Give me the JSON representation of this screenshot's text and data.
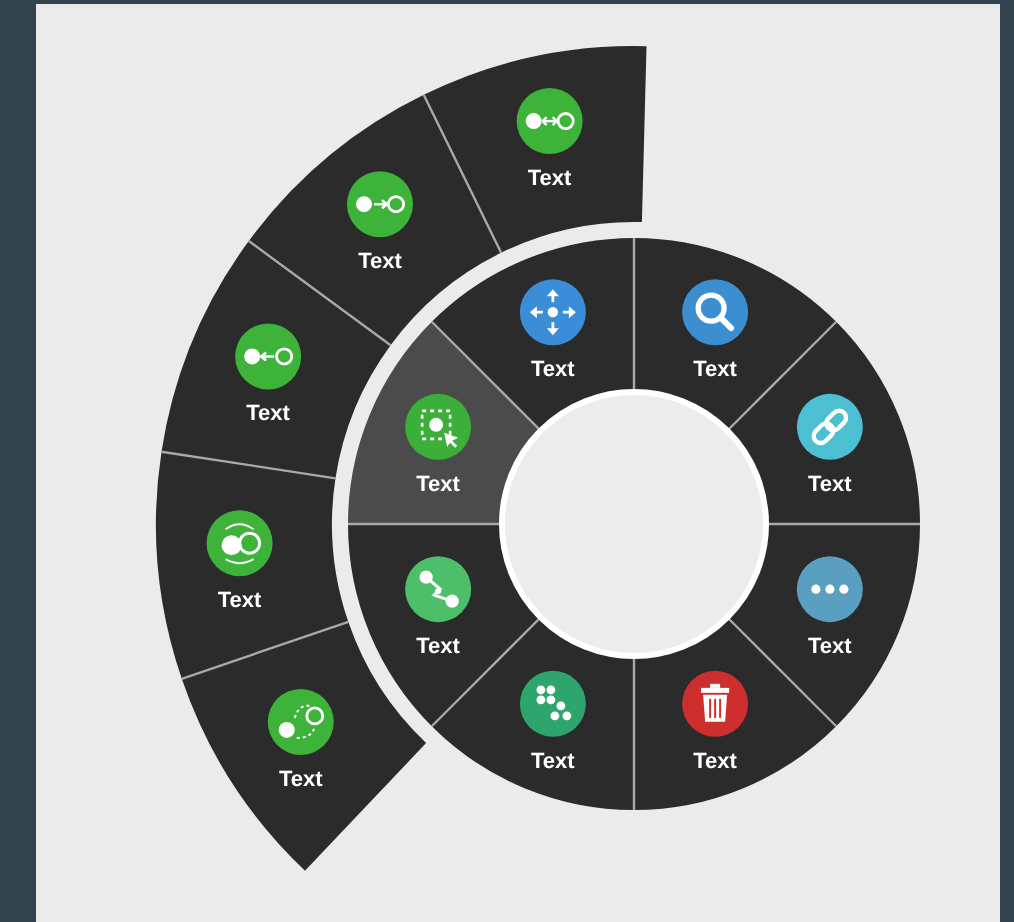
{
  "inner_ring": {
    "items": [
      {
        "kind": "search",
        "label": "Text",
        "color": "#3b8fd1",
        "selected": false
      },
      {
        "kind": "link",
        "label": "Text",
        "color": "#4cbfd3",
        "selected": false
      },
      {
        "kind": "more",
        "label": "Text",
        "color": "#5b9fc0",
        "selected": false
      },
      {
        "kind": "trash",
        "label": "Text",
        "color": "#cc2f2d",
        "selected": false
      },
      {
        "kind": "cluster",
        "label": "Text",
        "color": "#2fa56e",
        "selected": false
      },
      {
        "kind": "share",
        "label": "Text",
        "color": "#4dbf6a",
        "selected": false
      },
      {
        "kind": "select",
        "label": "Text",
        "color": "#3cae3a",
        "selected": true
      },
      {
        "kind": "move",
        "label": "Text",
        "color": "#3a8dd6",
        "selected": false
      }
    ]
  },
  "outer_ring": {
    "items": [
      {
        "kind": "dashed",
        "label": "Text"
      },
      {
        "kind": "cycle",
        "label": "Text"
      },
      {
        "kind": "left",
        "label": "Text"
      },
      {
        "kind": "right",
        "label": "Text"
      },
      {
        "kind": "both",
        "label": "Text"
      }
    ]
  }
}
